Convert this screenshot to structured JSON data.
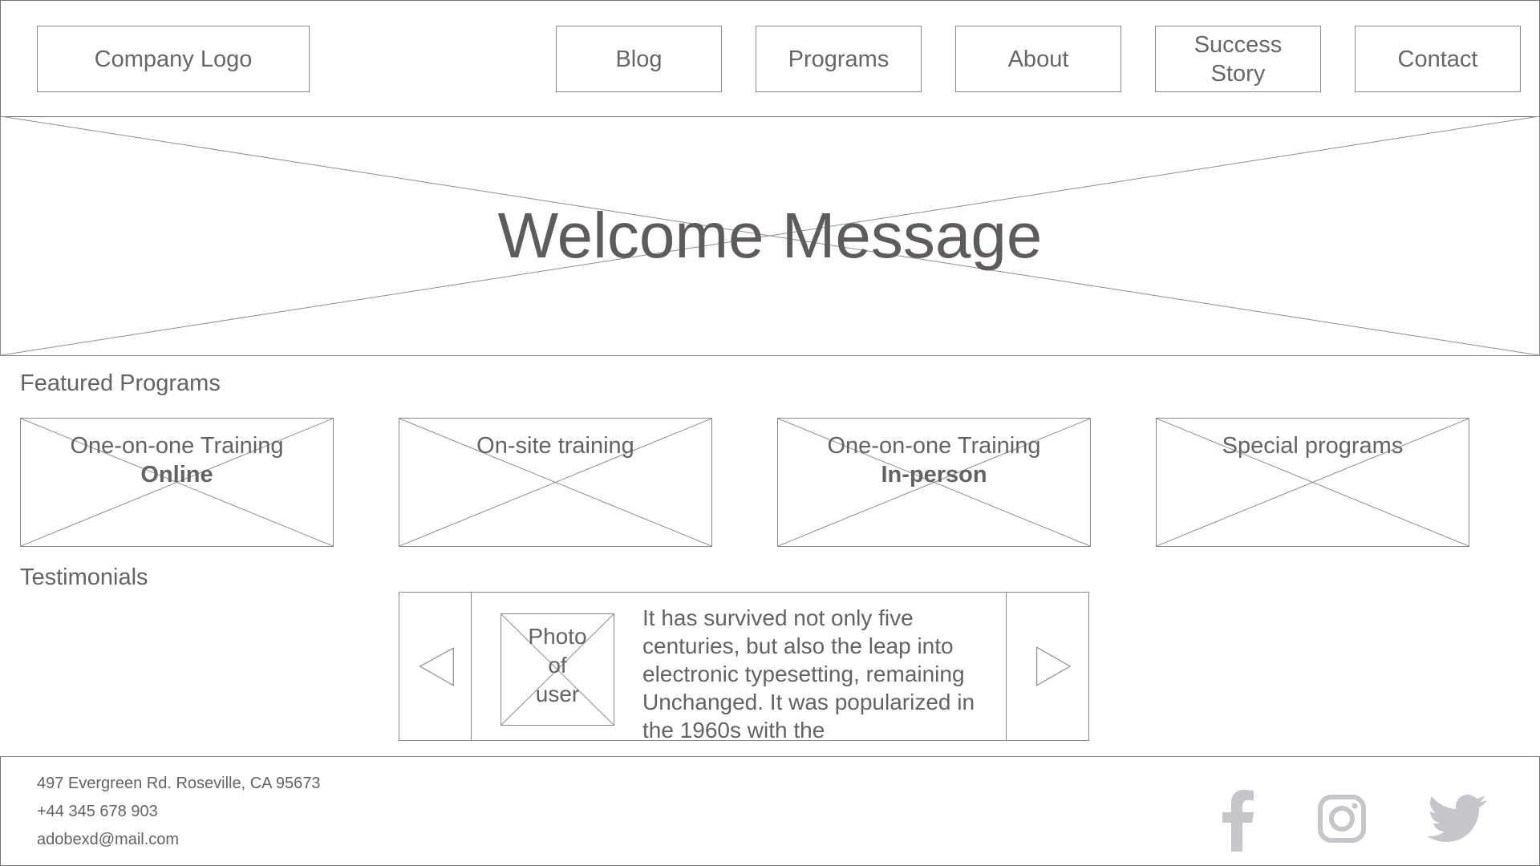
{
  "header": {
    "logo": "Company Logo",
    "nav": {
      "blog": "Blog",
      "programs": "Programs",
      "about": "About",
      "success_line1": "Success",
      "success_line2": "Story",
      "contact": "Contact"
    }
  },
  "hero": {
    "title": "Welcome Message"
  },
  "featured": {
    "title": "Featured Programs",
    "cards": [
      {
        "label": "One-on-one Training",
        "sub": "Online"
      },
      {
        "label": "On-site training",
        "sub": ""
      },
      {
        "label": "One-on-one Training",
        "sub": "In-person"
      },
      {
        "label": "Special programs",
        "sub": ""
      }
    ]
  },
  "testimonials": {
    "title": "Testimonials",
    "photo_label": [
      "Photo",
      "of",
      "user"
    ],
    "quote": "It has survived not only five centuries, but also the leap into electronic typesetting, remaining Unchanged. It was popularized in the 1960s with the"
  },
  "footer": {
    "address": "497 Evergreen Rd. Roseville, CA 95673",
    "phone": "+44 345 678 903",
    "email": "adobexd@mail.com",
    "social": [
      "facebook-icon",
      "instagram-icon",
      "twitter-icon"
    ],
    "icon_color": "#c4c6cc"
  }
}
